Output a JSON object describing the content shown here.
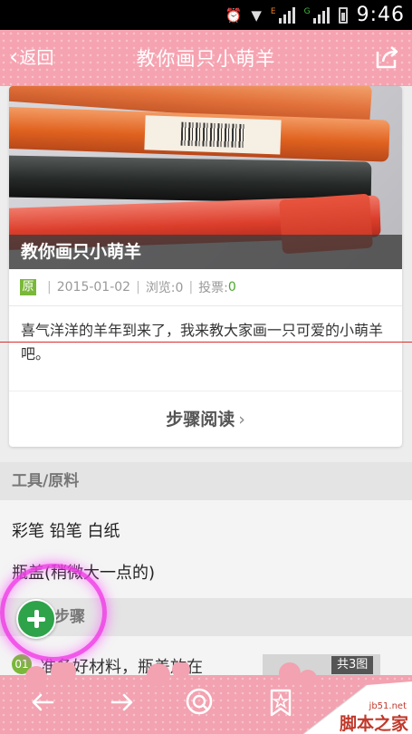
{
  "status_bar": {
    "time": "9:46",
    "net1": "E",
    "net2": "G"
  },
  "header": {
    "back_label": "返回",
    "title": "教你画只小萌羊",
    "share_icon": "share-icon"
  },
  "article": {
    "photo_caption": "教你画只小萌羊",
    "original_badge": "原",
    "date": "2015-01-02",
    "views": "浏览:0",
    "votes_label": "投票:",
    "votes_value": "0",
    "description": "喜气洋洋的羊年到来了，我来教大家画一只可爱的小萌羊吧。",
    "read_steps": "步骤阅读",
    "read_steps_arrow": "›"
  },
  "tools": {
    "heading": "工具/原料",
    "items": [
      "彩笔 铅笔 白纸",
      "瓶盖(稍微大一点的)"
    ]
  },
  "steps": {
    "heading": "步骤",
    "first": {
      "number": "01",
      "text": "准备好材料，瓶盖放在",
      "count": "共3图"
    }
  },
  "fab": {
    "icon": "plus-icon"
  },
  "bottom_nav": {
    "icons": [
      "back-arrow-icon",
      "forward-arrow-icon",
      "search-icon",
      "bookmark-star-icon"
    ]
  },
  "watermark": {
    "url": "jb51.net",
    "brand": "脚本之家"
  },
  "colors": {
    "header_pink": "#f6a3b1",
    "accent_green": "#7ab83a",
    "fab_green": "#2ea34a",
    "ring_magenta": "#f03ce6"
  }
}
